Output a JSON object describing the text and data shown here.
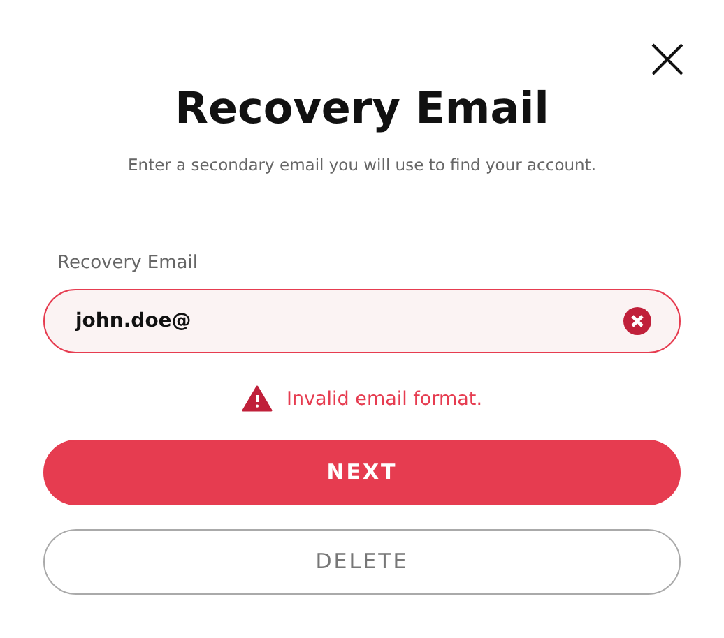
{
  "dialog": {
    "title": "Recovery Email",
    "subtitle": "Enter a secondary email you will use to find your account."
  },
  "field": {
    "label": "Recovery Email",
    "value": "john.doe@",
    "invalid": true
  },
  "error": "Invalid email format.",
  "buttons": [
    {
      "label": "NEXT",
      "kind": "primary"
    },
    {
      "label": "DELETE",
      "kind": "secondary"
    }
  ]
}
